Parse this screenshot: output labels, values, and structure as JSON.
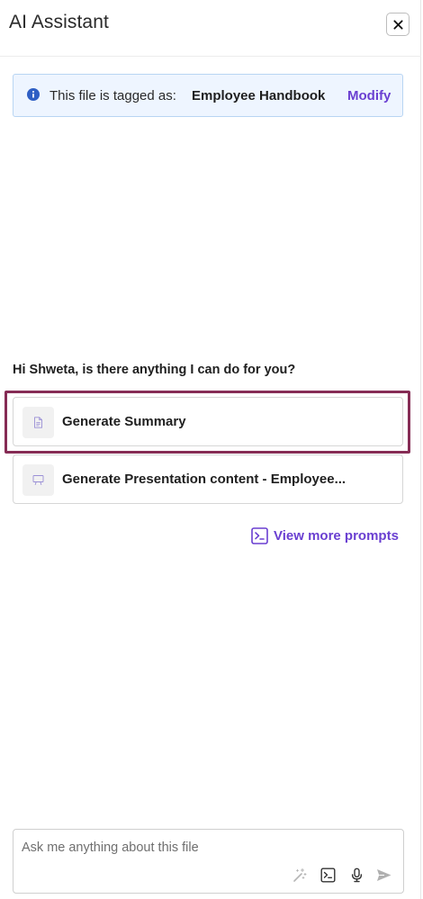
{
  "header": {
    "title": "AI Assistant",
    "close_icon": "close-icon"
  },
  "tag_banner": {
    "icon": "info-icon",
    "prefix": "This file is tagged as:",
    "value": "Employee Handbook",
    "action_label": "Modify"
  },
  "greeting": "Hi Shweta, is there anything I can do for you?",
  "prompts": [
    {
      "icon": "document-icon",
      "label": "Generate Summary",
      "highlighted": true
    },
    {
      "icon": "presentation-icon",
      "label": "Generate Presentation content - Employee..."
    }
  ],
  "view_more": {
    "icon": "prompt-terminal-icon",
    "label": "View more prompts"
  },
  "composer": {
    "placeholder": "Ask me anything about this file",
    "value": "",
    "tools": [
      "magic-wand-icon",
      "prompt-terminal-icon",
      "microphone-icon",
      "send-icon"
    ]
  },
  "colors": {
    "accent": "#6a3fd1",
    "highlight_border": "#862c55",
    "banner_bg": "#eef5ff",
    "banner_border": "#b9d5f3",
    "info_icon": "#2f5fc4"
  }
}
